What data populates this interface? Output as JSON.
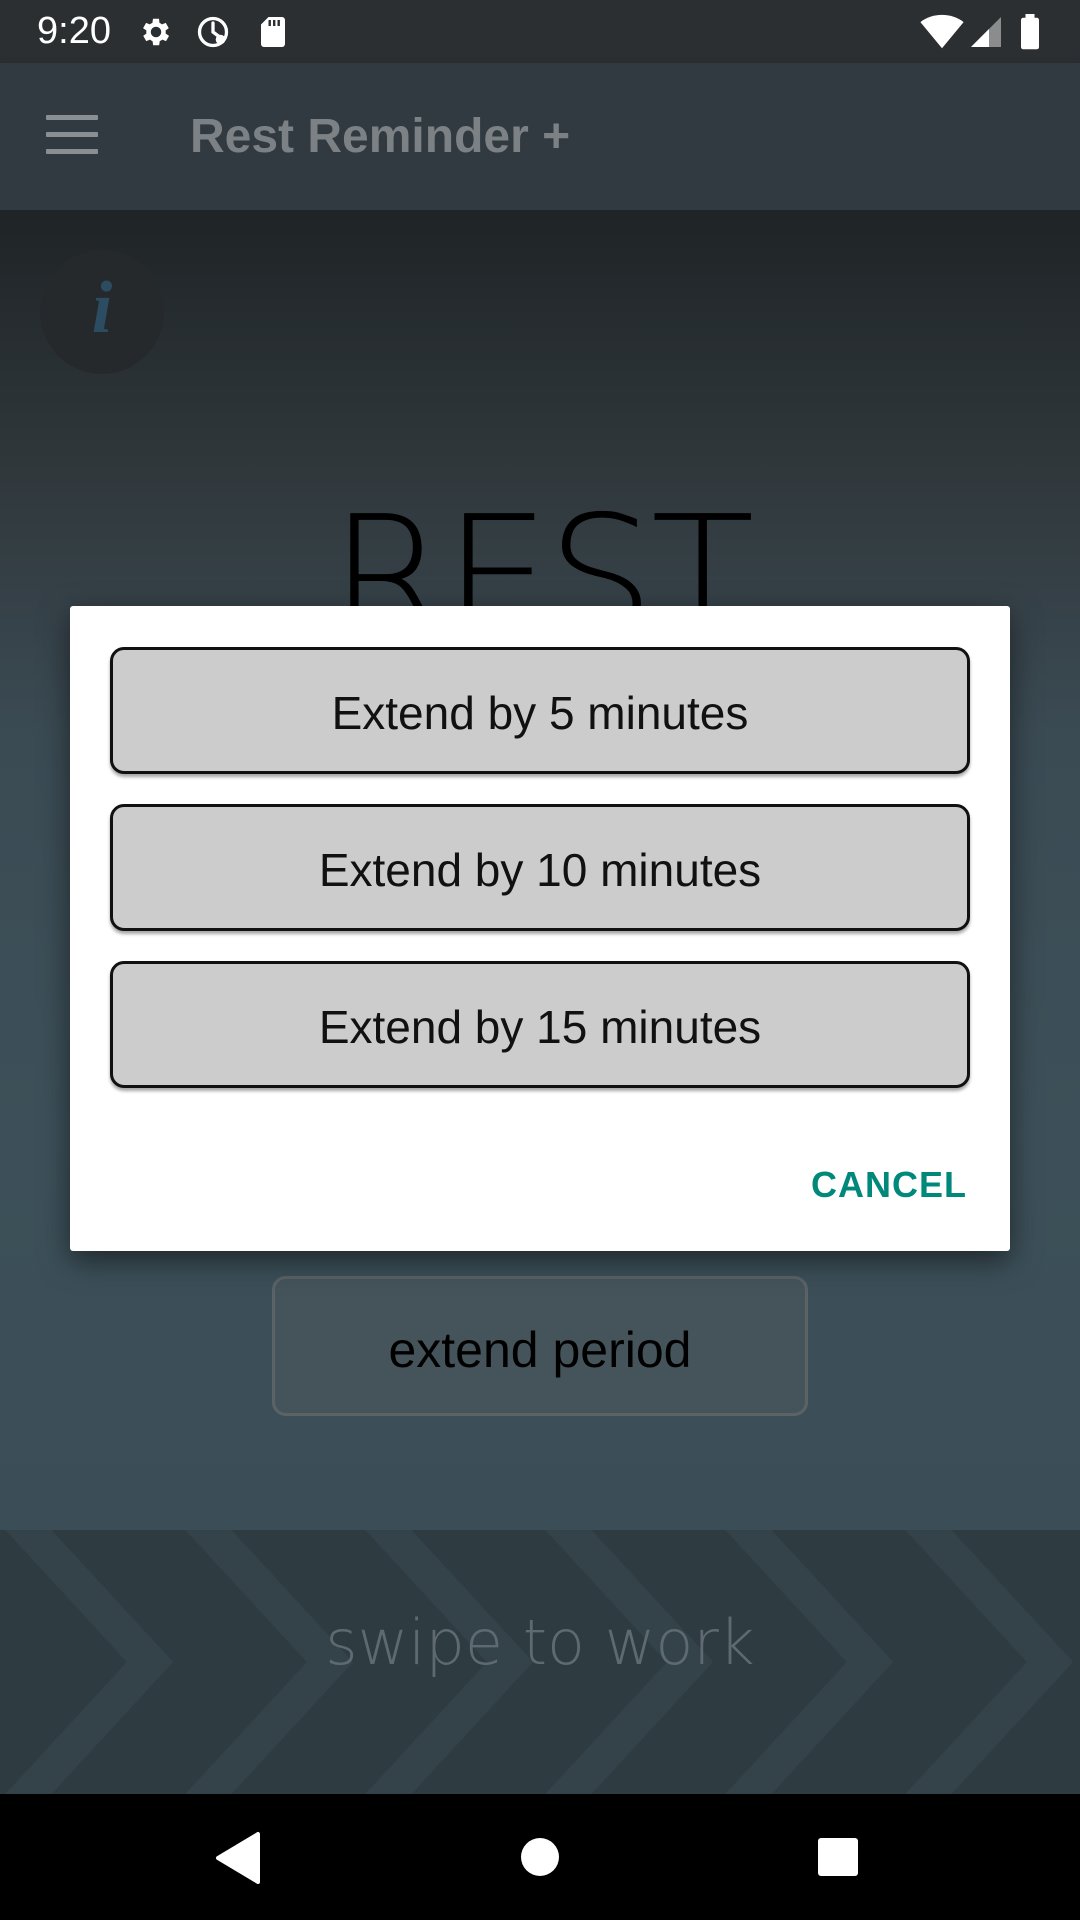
{
  "status_bar": {
    "time": "9:20",
    "left_icons": [
      "gear-icon",
      "data-saver-icon",
      "sd-card-icon"
    ],
    "right_icons": [
      "wifi-icon",
      "cell-signal-icon",
      "battery-icon"
    ]
  },
  "app_bar": {
    "menu_icon": "hamburger-menu-icon",
    "title": "Rest Reminder +"
  },
  "main": {
    "info_icon": "i",
    "mode_title": "REST",
    "extend_button_label": "extend period"
  },
  "swipe": {
    "label": "swipe to work"
  },
  "dialog": {
    "options": [
      {
        "label": "Extend by 5 minutes"
      },
      {
        "label": "Extend by 10 minutes"
      },
      {
        "label": "Extend by 15 minutes"
      }
    ],
    "cancel_label": "CANCEL",
    "accent_color": "#00897b"
  },
  "nav_bar": {
    "buttons": [
      "back-icon",
      "home-icon",
      "recents-icon"
    ]
  }
}
